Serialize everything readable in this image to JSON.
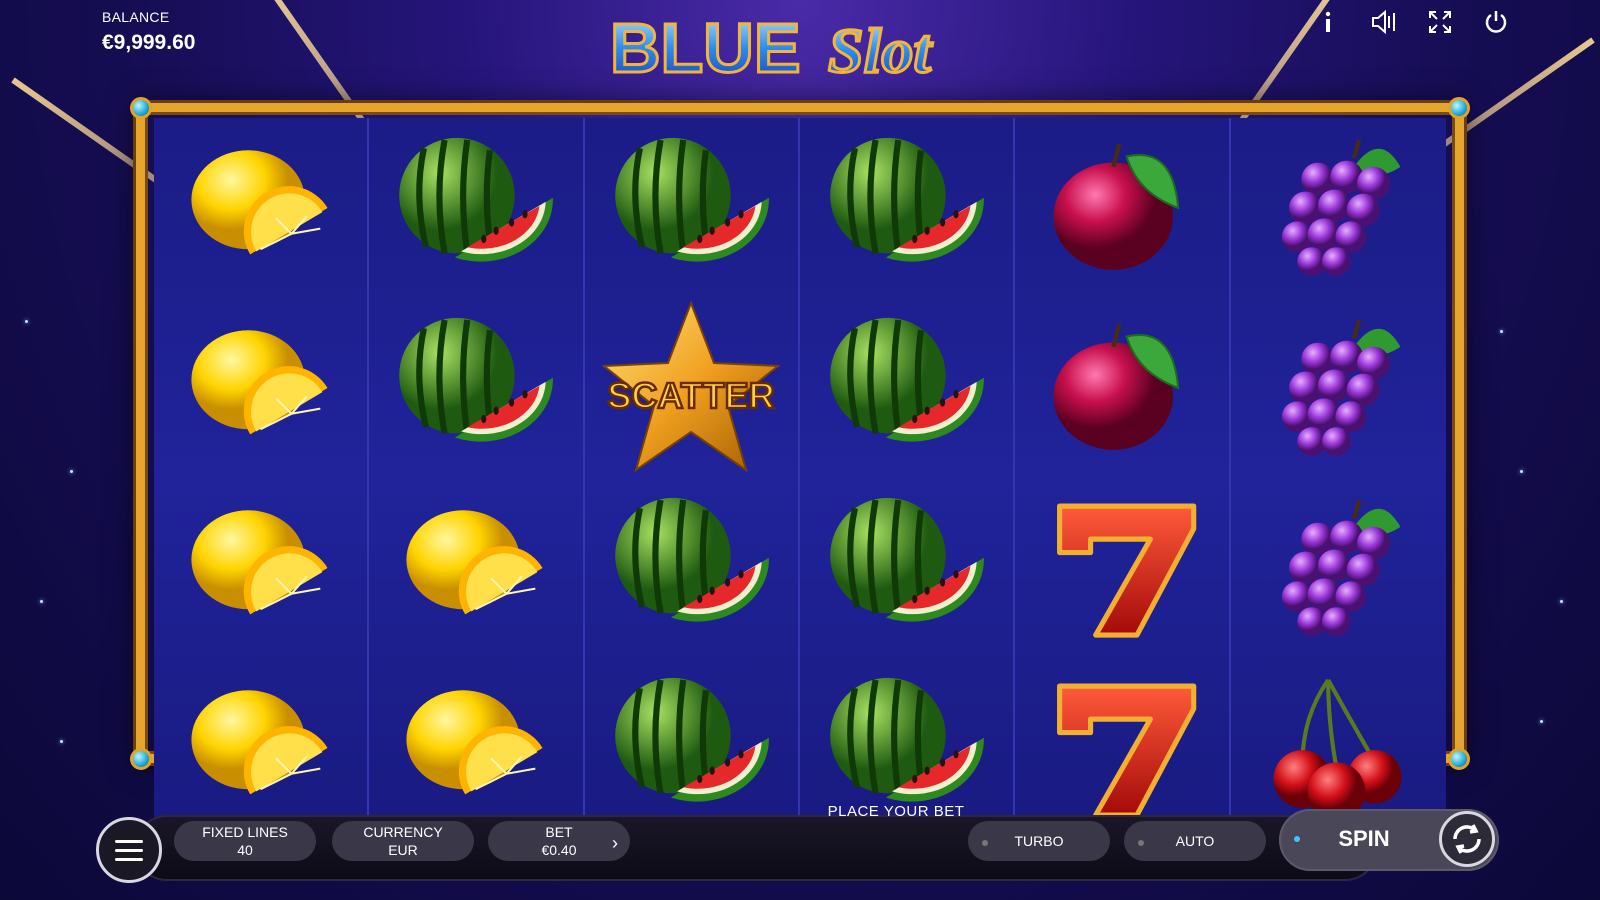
{
  "header": {
    "balance_label": "BALANCE",
    "balance_value": "€9,999.60",
    "logo_word1": "BLUE",
    "logo_word2": "Slot",
    "icons": [
      "info-icon",
      "sound-icon",
      "fullscreen-icon",
      "power-icon"
    ]
  },
  "reels": [
    [
      "lemon",
      "lemon",
      "lemon",
      "lemon"
    ],
    [
      "watermelon",
      "watermelon",
      "lemon",
      "lemon"
    ],
    [
      "watermelon",
      "scatter",
      "watermelon",
      "watermelon"
    ],
    [
      "watermelon",
      "watermelon",
      "watermelon",
      "watermelon"
    ],
    [
      "plum",
      "plum",
      "seven",
      "seven"
    ],
    [
      "grapes",
      "grapes",
      "grapes",
      "cherries"
    ]
  ],
  "scatter_text": "SCATTER",
  "footer": {
    "message": "PLACE YOUR BET",
    "fixed_lines_label": "FIXED LINES",
    "fixed_lines_value": "40",
    "currency_label": "CURRENCY",
    "currency_value": "EUR",
    "bet_label": "BET",
    "bet_value": "€0.40",
    "turbo_label": "TURBO",
    "auto_label": "AUTO",
    "spin_label": "SPIN"
  },
  "colors": {
    "frame_gold": "#e6a52c",
    "reel_blue": "#20239a",
    "spin_indicator": "#3ec7ff"
  }
}
